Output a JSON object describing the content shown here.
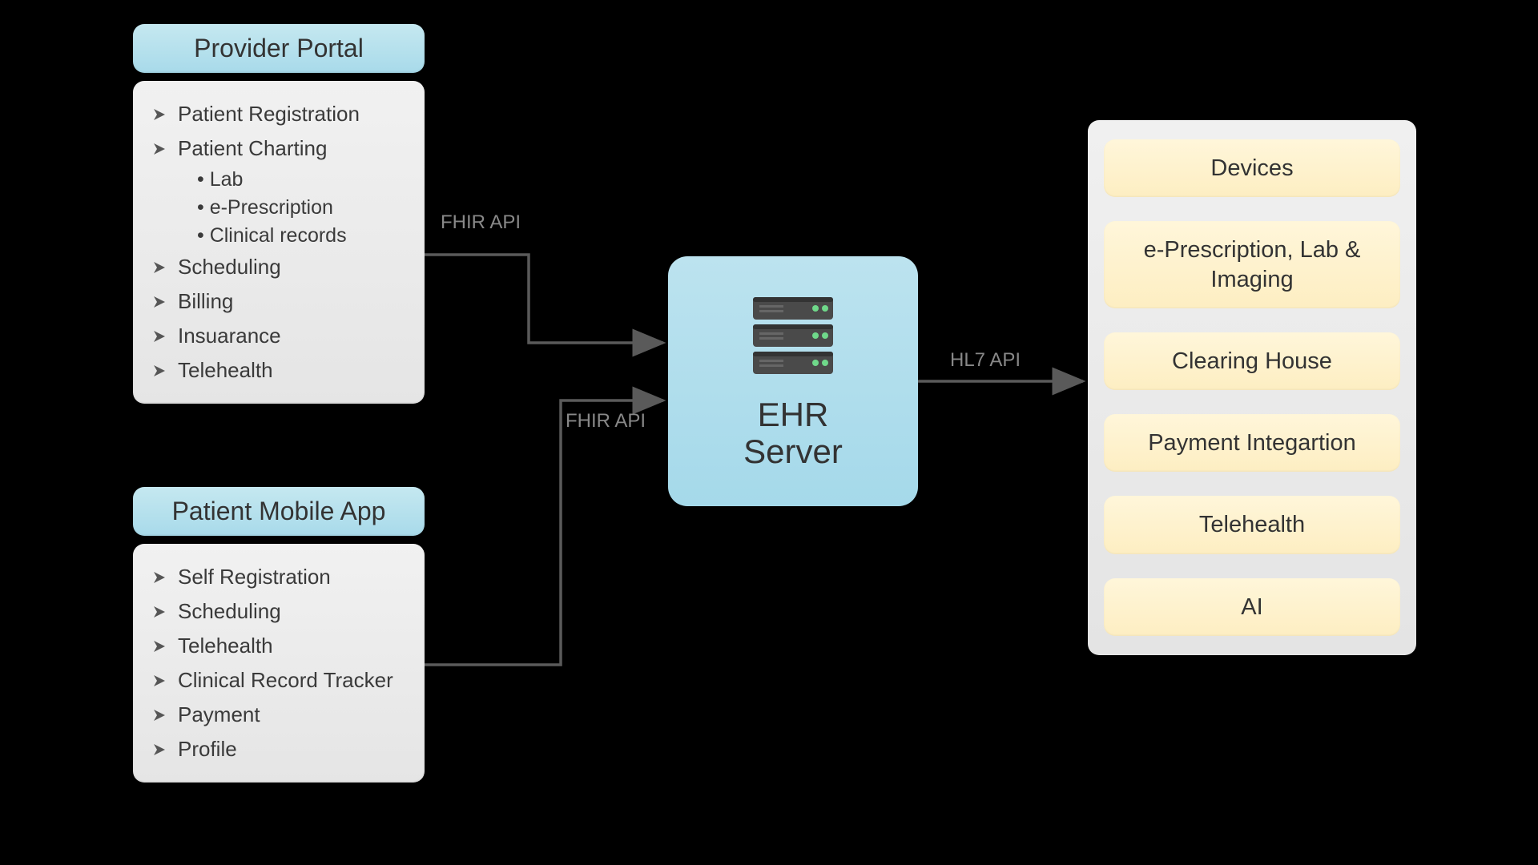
{
  "provider_portal": {
    "title": "Provider Portal",
    "features": [
      {
        "label": "Patient Registration",
        "subs": []
      },
      {
        "label": "Patient Charting",
        "subs": [
          "Lab",
          "e-Prescription",
          "Clinical records"
        ]
      },
      {
        "label": "Scheduling",
        "subs": []
      },
      {
        "label": "Billing",
        "subs": []
      },
      {
        "label": "Insuarance",
        "subs": []
      },
      {
        "label": "Telehealth",
        "subs": []
      }
    ]
  },
  "patient_app": {
    "title": "Patient Mobile App",
    "features": [
      {
        "label": "Self Registration",
        "subs": []
      },
      {
        "label": "Scheduling",
        "subs": []
      },
      {
        "label": "Telehealth",
        "subs": []
      },
      {
        "label": "Clinical Record Tracker",
        "subs": []
      },
      {
        "label": "Payment",
        "subs": []
      },
      {
        "label": "Profile",
        "subs": []
      }
    ]
  },
  "ehr": {
    "title_line1": "EHR",
    "title_line2": "Server"
  },
  "connectors": {
    "top_label": "FHIR API",
    "bottom_label": "FHIR API",
    "right_label": "HL7 API"
  },
  "services": [
    "Devices",
    "e-Prescription, Lab & Imaging",
    "Clearing House",
    "Payment Integartion",
    "Telehealth",
    "AI"
  ],
  "colors": {
    "panel_blue": "#a8daea",
    "panel_gray": "#e8e8e8",
    "service_yellow": "#fdeec2",
    "connector": "#5a5a5a"
  }
}
